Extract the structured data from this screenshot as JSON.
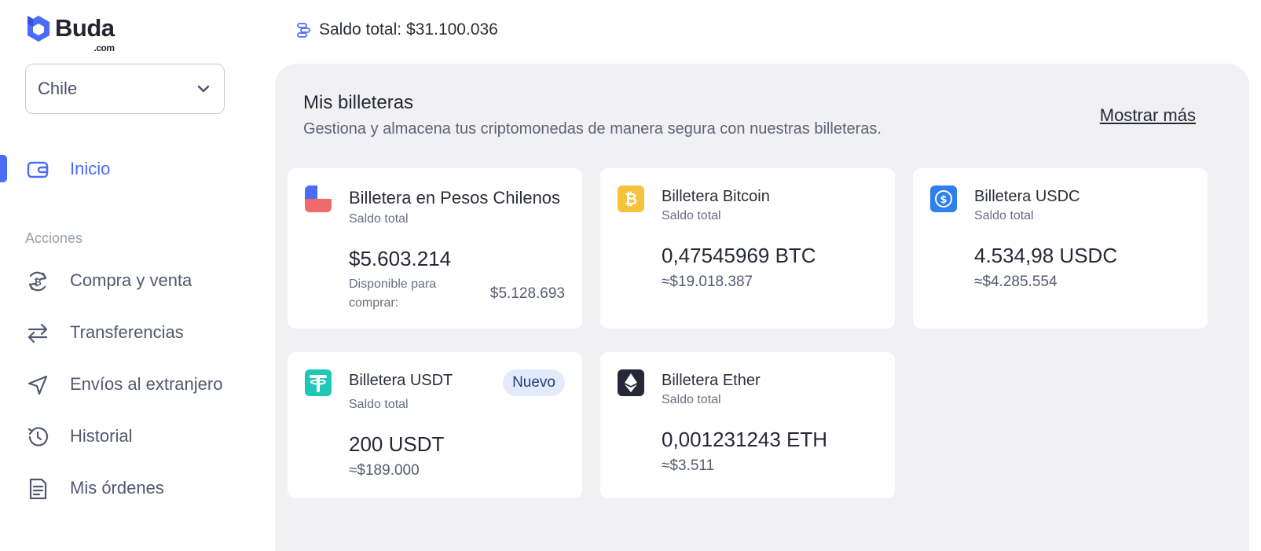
{
  "brand": {
    "name": "Buda",
    "suffix": ".com",
    "accent": "#4a6cf7"
  },
  "country_select": {
    "value": "Chile"
  },
  "nav": {
    "home": {
      "label": "Inicio"
    },
    "section_label": "Acciones",
    "items": [
      {
        "label": "Compra y venta",
        "icon": "bitcoin-exchange-icon"
      },
      {
        "label": "Transferencias",
        "icon": "transfer-arrows-icon"
      },
      {
        "label": "Envíos al extranjero",
        "icon": "send-icon"
      },
      {
        "label": "Historial",
        "icon": "history-icon"
      },
      {
        "label": "Mis órdenes",
        "icon": "orders-icon"
      }
    ]
  },
  "header": {
    "balance_label": "Saldo total:",
    "balance_value": "$31.100.036"
  },
  "wallets": {
    "title": "Mis billeteras",
    "subtitle": "Gestiona y almacena tus criptomonedas de manera segura con nuestras billeteras.",
    "show_more": "Mostrar más",
    "cards": [
      {
        "title": "Billetera en Pesos Chilenos",
        "subtitle": "Saldo total",
        "amount": "$5.603.214",
        "available_label": "Disponible para comprar:",
        "available_value": "$5.128.693",
        "icon": "chile-flag-icon"
      },
      {
        "title": "Billetera Bitcoin",
        "subtitle": "Saldo total",
        "amount": "0,47545969 BTC",
        "approx": "≈$19.018.387",
        "icon": "bitcoin-icon",
        "color": "#f7c23b"
      },
      {
        "title": "Billetera USDC",
        "subtitle": "Saldo total",
        "amount": "4.534,98 USDC",
        "approx": "≈$4.285.554",
        "icon": "usdc-icon",
        "color": "#2f80ed"
      },
      {
        "title": "Billetera USDT",
        "subtitle": "Saldo total",
        "badge": "Nuevo",
        "amount": "200 USDT",
        "approx": "≈$189.000",
        "icon": "tether-icon",
        "color": "#1fc7b6"
      },
      {
        "title": "Billetera Ether",
        "subtitle": "Saldo total",
        "amount": "0,001231243 ETH",
        "approx": "≈$3.511",
        "icon": "ether-icon",
        "color": "#262837"
      }
    ]
  }
}
